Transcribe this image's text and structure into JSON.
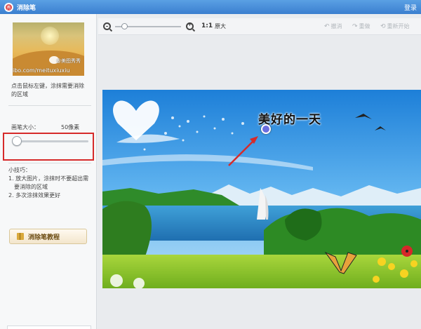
{
  "titlebar": {
    "logo_text": "秀",
    "title": "消除笔",
    "login": "登录"
  },
  "left": {
    "thumb_watermark_1": "@美图秀秀",
    "thumb_watermark_2": "ibo.com/meituxiuxiu",
    "hint": "点击鼠标左键，涂抹需要消除的区域",
    "brush_label": "画笔大小：",
    "brush_value": "50像素",
    "brush_level": 0.05,
    "tips_title": "小技巧：",
    "tips": [
      "1. 放大图片，涂抹时不要超出需要消除的区域",
      "2. 多次涂抹效果更好"
    ],
    "tutorial_button": "消除笔教程"
  },
  "toolbar": {
    "ratio": "1:1",
    "original": "原大",
    "undo": "撤消",
    "redo": "重做",
    "restart": "重新开始",
    "zoom_level": 0.1
  },
  "photo": {
    "caption": "美好的一天"
  },
  "colors": {
    "titlebar": "#3b7fcf",
    "highlight": "#d62a2a",
    "marker": "#6a6ee0"
  }
}
